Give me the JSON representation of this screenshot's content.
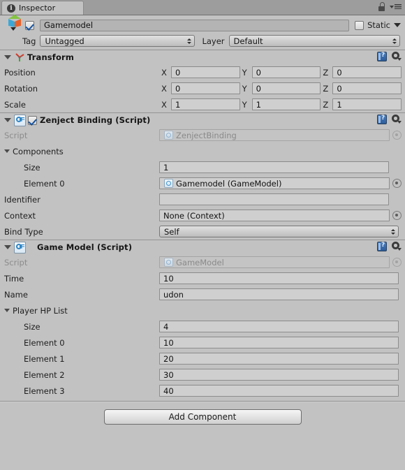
{
  "window": {
    "tab_label": "Inspector",
    "tab_icon": "info-icon",
    "lock_icon": "lock-icon",
    "menu_icon": "hamburger-menu-icon"
  },
  "header": {
    "object_icon": "gameobject-cube-icon",
    "enabled": true,
    "name": "Gamemodel",
    "static_label": "Static",
    "tag_label": "Tag",
    "tag_value": "Untagged",
    "layer_label": "Layer",
    "layer_value": "Default"
  },
  "components": [
    {
      "id": "transform",
      "title": "Transform",
      "icon": "transform-axis-icon",
      "has_enable_checkbox": false,
      "help_icon": "help-book-icon",
      "gear_icon": "settings-gear-icon",
      "rows": [
        {
          "label": "Position",
          "axes": [
            "X",
            "Y",
            "Z"
          ],
          "values": [
            "0",
            "0",
            "0"
          ]
        },
        {
          "label": "Rotation",
          "axes": [
            "X",
            "Y",
            "Z"
          ],
          "values": [
            "0",
            "0",
            "0"
          ]
        },
        {
          "label": "Scale",
          "axes": [
            "X",
            "Y",
            "Z"
          ],
          "values": [
            "1",
            "1",
            "1"
          ]
        }
      ]
    },
    {
      "id": "zenject-binding",
      "title": "Zenject Binding (Script)",
      "icon": "csharp-script-icon",
      "has_enable_checkbox": true,
      "enabled": true,
      "help_icon": "help-book-icon",
      "gear_icon": "settings-gear-icon",
      "rows": [
        {
          "label": "Script",
          "type": "object",
          "value": "ZenjectBinding",
          "disabled": true
        },
        {
          "label": "Components",
          "type": "foldout",
          "expanded": true
        },
        {
          "label": "Size",
          "type": "text",
          "value": "1",
          "indent": 2
        },
        {
          "label": "Element 0",
          "type": "object",
          "value": "Gamemodel (GameModel)",
          "indent": 2
        },
        {
          "label": "Identifier",
          "type": "text",
          "value": ""
        },
        {
          "label": "Context",
          "type": "object",
          "value": "None (Context)"
        },
        {
          "label": "Bind Type",
          "type": "popup",
          "value": "Self"
        }
      ]
    },
    {
      "id": "game-model",
      "title": "Game Model (Script)",
      "icon": "csharp-script-icon",
      "has_enable_checkbox": false,
      "help_icon": "help-book-icon",
      "gear_icon": "settings-gear-icon",
      "rows": [
        {
          "label": "Script",
          "type": "object",
          "value": "GameModel",
          "disabled": true
        },
        {
          "label": "Time",
          "type": "text",
          "value": "10"
        },
        {
          "label": "Name",
          "type": "text",
          "value": "udon"
        },
        {
          "label": "Player HP List",
          "type": "foldout",
          "expanded": true
        },
        {
          "label": "Size",
          "type": "text",
          "value": "4",
          "indent": 2
        },
        {
          "label": "Element 0",
          "type": "text",
          "value": "10",
          "indent": 2
        },
        {
          "label": "Element 1",
          "type": "text",
          "value": "20",
          "indent": 2
        },
        {
          "label": "Element 2",
          "type": "text",
          "value": "30",
          "indent": 2
        },
        {
          "label": "Element 3",
          "type": "text",
          "value": "40",
          "indent": 2
        }
      ]
    }
  ],
  "footer": {
    "add_component_label": "Add Component"
  },
  "colors": {
    "background": "#c2c2c2",
    "tabbar": "#9d9d9d",
    "field": "#cfcfcf",
    "accent_blue": "#16539e"
  }
}
